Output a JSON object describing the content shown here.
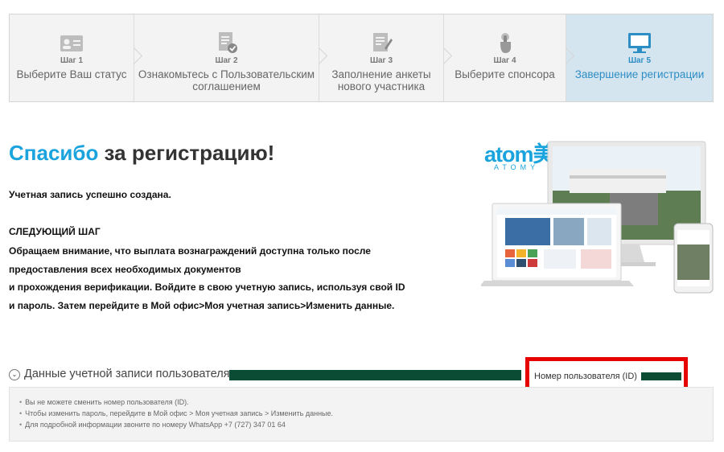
{
  "steps": [
    {
      "num": "Шаг 1",
      "label": "Выберите Ваш статус",
      "icon": "id-card-icon"
    },
    {
      "num": "Шаг 2",
      "label": "Ознакомьтесь с Пользовательским соглашением",
      "icon": "document-check-icon"
    },
    {
      "num": "Шаг 3",
      "label": "Заполнение анкеты нового участника",
      "icon": "form-pen-icon"
    },
    {
      "num": "Шаг 4",
      "label": "Выберите спонсора",
      "icon": "pointer-hand-icon"
    },
    {
      "num": "Шаг 5",
      "label": "Завершение регистрации",
      "icon": "monitor-icon"
    }
  ],
  "heading": {
    "highlight": "Спасибо",
    "rest": " за регистрацию!"
  },
  "created": "Учетная запись успешно создана.",
  "next_step": {
    "title": "СЛЕДУЮЩИЙ ШАГ",
    "lines": [
      "Обращаем внимание, что выплата вознаграждений доступна только после",
      "предоставления всех необходимых документов",
      "и прохождения верификации. Войдите в свою учетную запись, используя свой ID",
      "и пароль. Затем перейдите в Мой офис>Моя учетная запись>Изменить данные."
    ]
  },
  "brand": {
    "word": "atom美",
    "sub": "ATOMY"
  },
  "account": {
    "label": "Данные учетной записи пользователя",
    "id_label": "Номер пользователя (ID)"
  },
  "notes": [
    "Вы не можете сменить номер пользователя (ID).",
    "Чтобы изменить пароль, перейдите в Мой офис > Моя учетная запись > Изменить данные.",
    "Для подробной информации звоните по номеру WhatsApp +7 (727) 347 01 64"
  ],
  "colors": {
    "accent": "#1aa3dc",
    "active_step_bg": "#d5e5f0",
    "highlight_box": "#e60000"
  }
}
